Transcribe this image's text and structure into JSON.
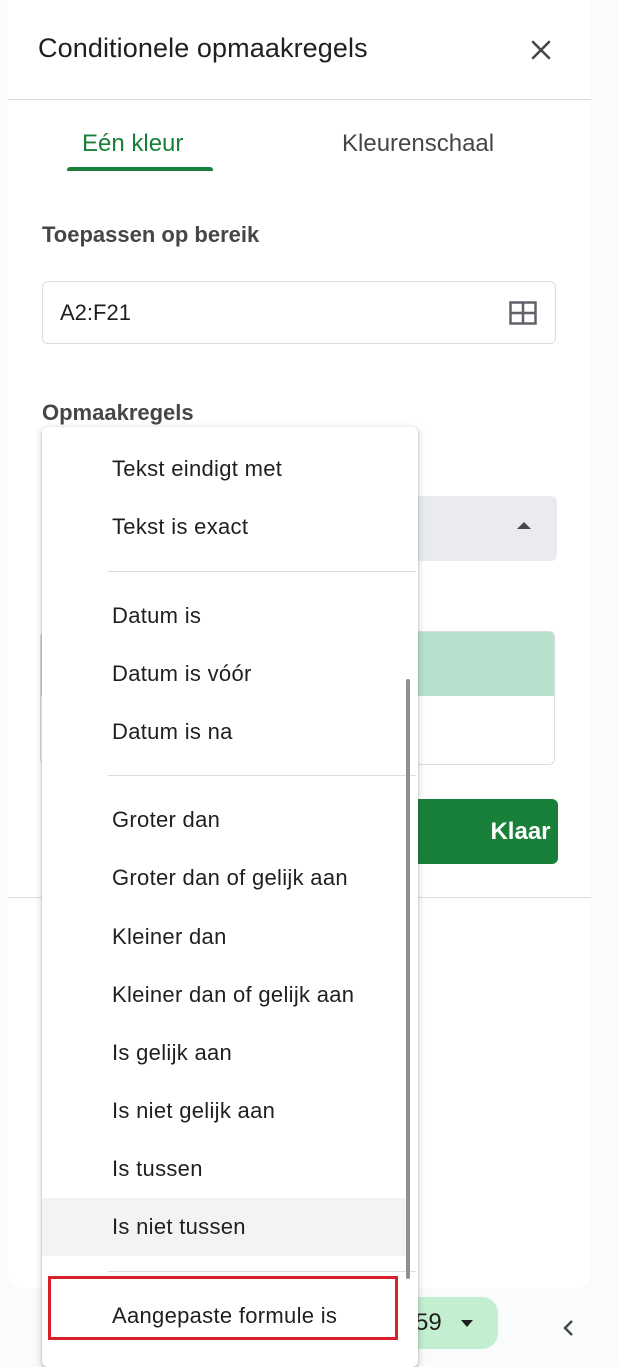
{
  "panel": {
    "title": "Conditionele opmaakregels",
    "close_icon": "close-icon"
  },
  "tabs": [
    {
      "label": "Eén kleur",
      "active": true
    },
    {
      "label": "Kleurenschaal",
      "active": false
    }
  ],
  "range": {
    "label": "Toepassen op bereik",
    "value": "A2:F21",
    "icon": "grid-select-icon"
  },
  "rules": {
    "label": "Opmaakregels"
  },
  "done_button": "Klaar",
  "bottom": {
    "chip_text": "59",
    "chevron_icon": "chevron-left-icon"
  },
  "menu": {
    "groups": [
      [
        "Tekst eindigt met",
        "Tekst is exact"
      ],
      [
        "Datum is",
        "Datum is vóór",
        "Datum is na"
      ],
      [
        "Groter dan",
        "Groter dan of gelijk aan",
        "Kleiner dan",
        "Kleiner dan of gelijk aan",
        "Is gelijk aan",
        "Is niet gelijk aan",
        "Is tussen",
        "Is niet tussen"
      ],
      [
        "Aangepaste formule is"
      ]
    ],
    "highlighted": "Is niet tussen",
    "marked": "Aangepaste formule is"
  },
  "colors": {
    "accent": "#188038",
    "preview_fill": "#b7e1cd",
    "chip": "#c4eed0",
    "marker": "#d7222a"
  }
}
